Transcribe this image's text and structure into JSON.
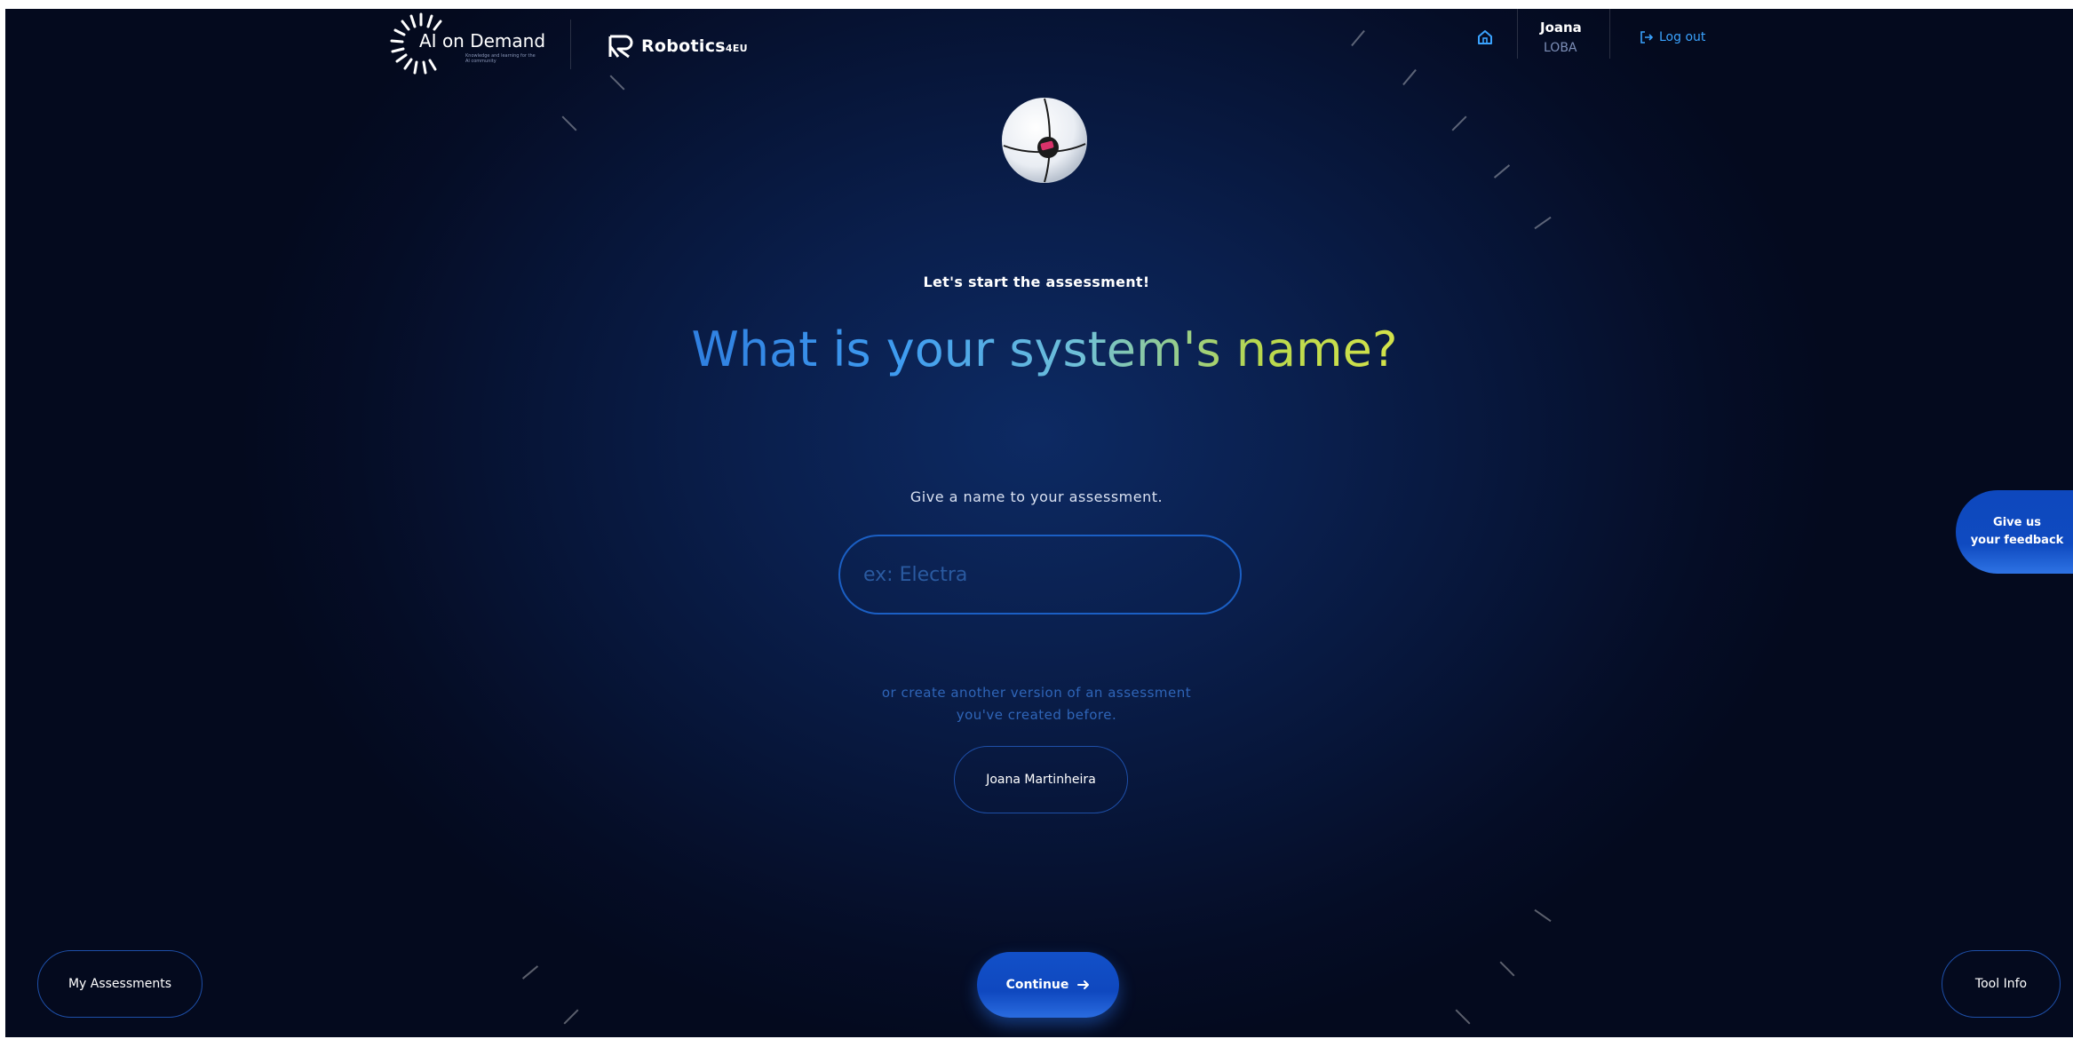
{
  "header": {
    "aiod_logo_text": "AI on Demand",
    "aiod_logo_subtext": "Knowledge and learning for the AI community",
    "robotics_logo_text": "Robotics",
    "robotics_logo_suffix": "4EU",
    "home_icon": "home-icon",
    "user_first_name": "Joana",
    "user_last_name": "LOBA",
    "logout_icon": "logout-icon",
    "logout_label": "Log out"
  },
  "main": {
    "avatar_icon": "robot-avatar-icon",
    "eyebrow": "Let's start the assessment!",
    "headline": "What is your system's name?",
    "subtitle": "Give a name to your assessment.",
    "name_input_placeholder": "ex: Electra",
    "name_input_value": "",
    "or_text_line1": "or create another version of an assessment",
    "or_text_line2": "you've created before.",
    "previous_assessment_label": "Joana Martinheira"
  },
  "footer": {
    "my_assessments_label": "My Assessments",
    "continue_label": "Continue",
    "continue_icon": "arrow-right-icon",
    "tool_info_label": "Tool Info"
  },
  "feedback": {
    "line1": "Give us",
    "line2": "your feedback"
  },
  "colors": {
    "background": "#07163a",
    "accent_blue": "#1250c8",
    "link_blue": "#3aa3ff",
    "headline_gradient_start": "#2f7fe0",
    "headline_gradient_end": "#d4e34a"
  }
}
